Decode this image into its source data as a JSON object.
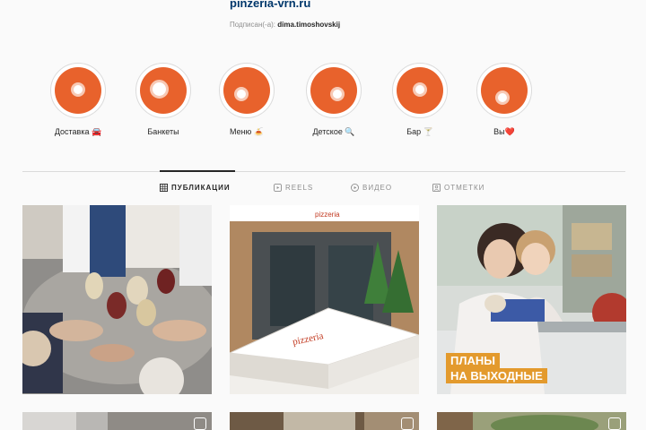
{
  "header": {
    "website": "pinzeria-vrn.ru",
    "followed_by_prefix": "Подписан(-а):",
    "followed_by_user": "dima.timoshovskij"
  },
  "highlights": [
    {
      "label": "Доставка 🚘"
    },
    {
      "label": "Банкеты"
    },
    {
      "label": "Меню 🍝"
    },
    {
      "label": "Детское 🔍"
    },
    {
      "label": "Бар 🍸"
    },
    {
      "label": "Вы❤️"
    }
  ],
  "tabs": [
    {
      "label": "ПУБЛИКАЦИИ",
      "icon": "grid-icon",
      "active": true
    },
    {
      "label": "REELS",
      "icon": "reels-icon",
      "active": false
    },
    {
      "label": "ВИДЕО",
      "icon": "video-icon",
      "active": false
    },
    {
      "label": "ОТМЕТКИ",
      "icon": "tagged-icon",
      "active": false
    }
  ],
  "posts": [
    {
      "alt": "toast"
    },
    {
      "alt": "pizza box"
    },
    {
      "alt": "mother and child",
      "badge_lines": [
        "ПЛАНЫ",
        "НА ВЫХОДНЫЕ"
      ]
    }
  ],
  "colors": {
    "accent": "#e8622c",
    "link": "#00376b",
    "badge": "#e39a2d"
  }
}
